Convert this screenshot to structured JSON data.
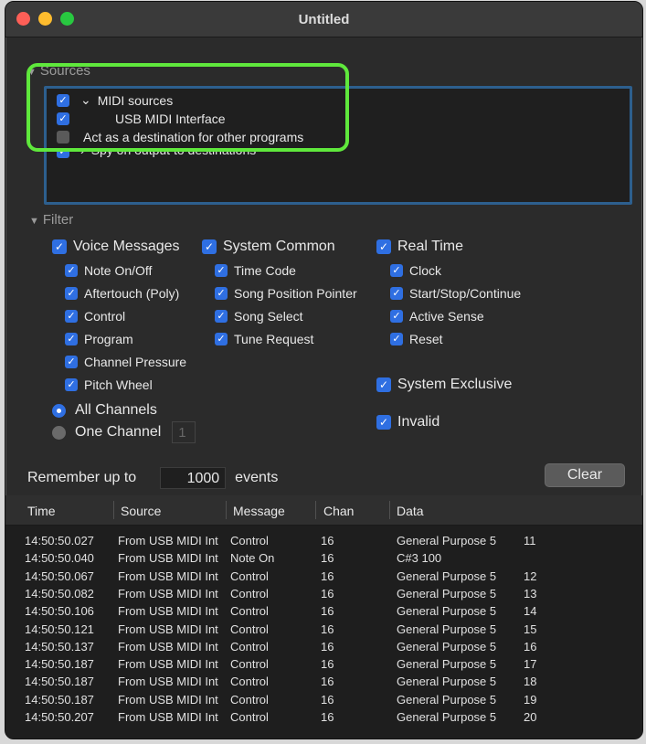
{
  "window": {
    "title": "Untitled"
  },
  "sources": {
    "label": "Sources",
    "items": [
      {
        "label": "MIDI sources",
        "checked": true,
        "chevron": "⌄"
      },
      {
        "label": "USB MIDI Interface",
        "checked": true
      },
      {
        "label": "Act as a destination for other programs",
        "checked": false
      },
      {
        "label": "Spy on output to destinations",
        "checked": true,
        "chevron": "›"
      }
    ]
  },
  "filter": {
    "label": "Filter",
    "voice": {
      "label": "Voice Messages",
      "items": [
        "Note On/Off",
        "Aftertouch (Poly)",
        "Control",
        "Program",
        "Channel Pressure",
        "Pitch Wheel"
      ]
    },
    "system_common": {
      "label": "System Common",
      "items": [
        "Time Code",
        "Song Position Pointer",
        "Song Select",
        "Tune Request"
      ]
    },
    "real_time": {
      "label": "Real Time",
      "items": [
        "Clock",
        "Start/Stop/Continue",
        "Active Sense",
        "Reset"
      ]
    },
    "system_exclusive": "System Exclusive",
    "invalid": "Invalid",
    "all_channels": "All Channels",
    "one_channel": "One Channel",
    "one_channel_value": "1"
  },
  "remember": {
    "prefix": "Remember up to",
    "count": "1000",
    "suffix": "events"
  },
  "clear_label": "Clear",
  "table": {
    "columns": [
      "Time",
      "Source",
      "Message",
      "Chan",
      "Data"
    ],
    "rows": [
      {
        "time": "14:50:50.027",
        "source": "From USB MIDI Int",
        "message": "Control",
        "chan": "16",
        "data": "General Purpose 5",
        "value": "11"
      },
      {
        "time": "14:50:50.040",
        "source": "From USB MIDI Int",
        "message": "Note On",
        "chan": "16",
        "data": "C#3  100",
        "value": ""
      },
      {
        "time": "14:50:50.067",
        "source": "From USB MIDI Int",
        "message": "Control",
        "chan": "16",
        "data": "General Purpose 5",
        "value": "12"
      },
      {
        "time": "14:50:50.082",
        "source": "From USB MIDI Int",
        "message": "Control",
        "chan": "16",
        "data": "General Purpose 5",
        "value": "13"
      },
      {
        "time": "14:50:50.106",
        "source": "From USB MIDI Int",
        "message": "Control",
        "chan": "16",
        "data": "General Purpose 5",
        "value": "14"
      },
      {
        "time": "14:50:50.121",
        "source": "From USB MIDI Int",
        "message": "Control",
        "chan": "16",
        "data": "General Purpose 5",
        "value": "15"
      },
      {
        "time": "14:50:50.137",
        "source": "From USB MIDI Int",
        "message": "Control",
        "chan": "16",
        "data": "General Purpose 5",
        "value": "16"
      },
      {
        "time": "14:50:50.187",
        "source": "From USB MIDI Int",
        "message": "Control",
        "chan": "16",
        "data": "General Purpose 5",
        "value": "17"
      },
      {
        "time": "14:50:50.187",
        "source": "From USB MIDI Int",
        "message": "Control",
        "chan": "16",
        "data": "General Purpose 5",
        "value": "18"
      },
      {
        "time": "14:50:50.187",
        "source": "From USB MIDI Int",
        "message": "Control",
        "chan": "16",
        "data": "General Purpose 5",
        "value": "19"
      },
      {
        "time": "14:50:50.207",
        "source": "From USB MIDI Int",
        "message": "Control",
        "chan": "16",
        "data": "General Purpose 5",
        "value": "20"
      }
    ]
  },
  "colors": {
    "highlight": "#5fe83c",
    "focus_ring": "#2d5f8e",
    "checkbox": "#2f6fe2"
  }
}
